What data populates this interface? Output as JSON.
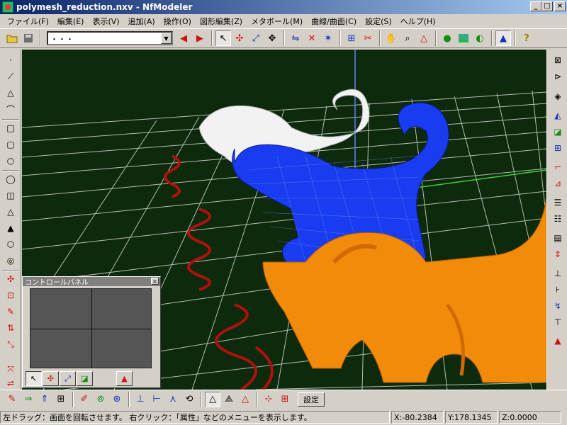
{
  "window": {
    "title": "polymesh_reduction.nxv - NfModeler",
    "minimize": "_",
    "maximize": "□",
    "close": "×"
  },
  "menu": [
    "ファイル(F)",
    "編集(E)",
    "表示(V)",
    "追加(A)",
    "操作(O)",
    "図形編集(Z)",
    "メタボール(M)",
    "曲線/曲面(C)",
    "設定(S)",
    "ヘルプ(H)"
  ],
  "toolbar": {
    "combo_value": "・・・"
  },
  "control_panel": {
    "title": "コントロールパネル",
    "close": "×"
  },
  "bottom_toolbar": {
    "settings_label": "設定"
  },
  "status": {
    "hint": "左ドラッグ：画面を回転させます。 右クリック：「属性」などのメニューを表示します。",
    "x": "X:-80.2384",
    "y": "Y:178.1345",
    "z": "Z:0.0000"
  },
  "colors": {
    "viewport_bg": "#0d2a0d",
    "grid": "#cfd8cf",
    "mesh_blue": "#1a3cf0",
    "mesh_orange": "#f28a0a",
    "mesh_white": "#f2f2f2",
    "curve_red": "#b01010"
  }
}
